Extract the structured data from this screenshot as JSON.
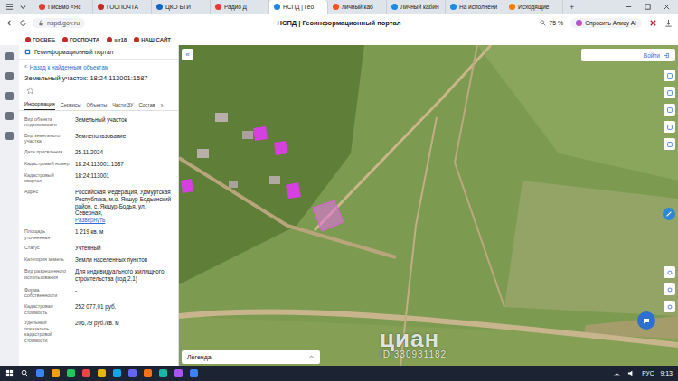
{
  "browser": {
    "tabs": [
      {
        "label": "Письмо «Яс",
        "selected": false,
        "color": "#e53935"
      },
      {
        "label": "ГОСПОЧТА",
        "selected": false,
        "color": "#c62828"
      },
      {
        "label": "ЦКО БТИ",
        "selected": false,
        "color": "#1565c0"
      },
      {
        "label": "Радио Д",
        "selected": false,
        "color": "#e53935"
      },
      {
        "label": "НСПД | Гео",
        "selected": true,
        "color": "#1e88e5"
      },
      {
        "label": "личный каб",
        "selected": false,
        "color": "#f4511e"
      },
      {
        "label": "Личный кабин",
        "selected": false,
        "color": "#1e88e5"
      },
      {
        "label": "На исполнени",
        "selected": false,
        "color": "#1e88e5"
      },
      {
        "label": "Исходящие",
        "selected": false,
        "color": "#f57c00"
      }
    ],
    "new_tab": "+",
    "address": "nspd.gov.ru",
    "page_title": "НСПД | Геоинформационный портал",
    "zoom": "75 %",
    "alice": "Спросить Алису AI",
    "bookmarks": [
      "ГОСВЕБ",
      "ГОСПОЧТА",
      "sir18",
      "НАШ САЙТ"
    ]
  },
  "panel": {
    "portal": "Геоинформационный портал",
    "back_icon": "‹",
    "back": "Назад к найденным объектам",
    "title": "Земельный участок: 18:24:113001:1587",
    "favorite": false,
    "tabs": [
      {
        "label": "Информация",
        "selected": true
      },
      {
        "label": "Сервисы",
        "selected": false
      },
      {
        "label": "Объекты",
        "selected": false
      },
      {
        "label": "Части ЗУ",
        "selected": false
      },
      {
        "label": "Состав",
        "selected": false
      }
    ],
    "tabs_more": "›",
    "fields": [
      {
        "label": "Вид объекта недвижимости",
        "value": "Земельный участок"
      },
      {
        "label": "Вид земельного участка",
        "value": "Землепользование"
      },
      {
        "label": "Дата присвоения",
        "value": "25.11.2024"
      },
      {
        "label": "Кадастровый номер",
        "value": "18:24:113001:1587"
      },
      {
        "label": "Кадастровый квартал",
        "value": "18:24:113001"
      },
      {
        "label": "Адрес",
        "value": "Российская Федерация, Удмуртская Республика, м.о. Якшур-Бодьинский район, с. Якшур-Бодья, ул. Северная,",
        "link": "Развернуть"
      },
      {
        "label": "Площадь уточненная",
        "value": "1 219 кв. м"
      },
      {
        "label": "Статус",
        "value": "Учтенный"
      },
      {
        "label": "Категория земель",
        "value": "Земли населенных пунктов"
      },
      {
        "label": "Вид разрешенного использования",
        "value": "Для индивидуального жилищного строительства (код 2.1)"
      },
      {
        "label": "Форма собственности",
        "value": "-"
      },
      {
        "label": "Кадастровая стоимость",
        "value": "252 077,01 руб."
      },
      {
        "label": "Удельный показатель кадастровой стоимости",
        "value": "206,79 руб./кв. м"
      }
    ]
  },
  "map": {
    "collapse": "«",
    "login": "Войти",
    "legend": "Легенда",
    "watermark": {
      "logo": "циан",
      "id": "ID 330931182"
    }
  },
  "taskbar": {
    "lang": "РУС",
    "time": "9:13"
  }
}
